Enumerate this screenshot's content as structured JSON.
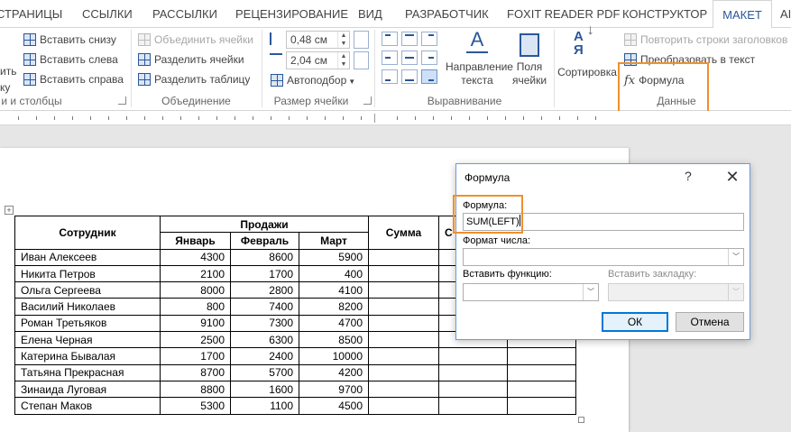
{
  "tabs": [
    "СТРАНИЦЫ",
    "ССЫЛКИ",
    "РАССЫЛКИ",
    "РЕЦЕНЗИРОВАНИЕ",
    "ВИД",
    "РАЗРАБОТЧИК",
    "FOXIT READER PDF",
    "КОНСТРУКТОР",
    "МАКЕТ",
    "AI"
  ],
  "ribbon": {
    "rows_cols": {
      "cut_label1": "ить",
      "cut_label2": "ку",
      "insert_below": "Вставить снизу",
      "insert_left": "Вставить слева",
      "insert_right": "Вставить справа",
      "group": "и и столбцы"
    },
    "merge": {
      "merge_cells": "Объединить ячейки",
      "split_cells": "Разделить ячейки",
      "split_table": "Разделить таблицу",
      "group": "Объединение"
    },
    "cell_size": {
      "height": "0,48 см",
      "width": "2,04 см",
      "autofit": "Автоподбор",
      "group": "Размер ячейки"
    },
    "alignment": {
      "text_direction_l1": "Направление",
      "text_direction_l2": "текста",
      "margins_l1": "Поля",
      "margins_l2": "ячейки",
      "group": "Выравнивание"
    },
    "data": {
      "sort": "Сортировка",
      "repeat_headers": "Повторить строки заголовков",
      "convert": "Преобразовать в текст",
      "formula": "Формула",
      "formula_icon": "fx",
      "group": "Данные"
    }
  },
  "table": {
    "head_employee": "Сотрудник",
    "head_sales": "Продажи",
    "head_sum": "Сумма",
    "head_extra": "С",
    "months": [
      "Январь",
      "Февраль",
      "Март"
    ],
    "rows": [
      [
        "Иван Алексеев",
        "4300",
        "8600",
        "5900"
      ],
      [
        "Никита Петров",
        "2100",
        "1700",
        "400"
      ],
      [
        "Ольга Сергеева",
        "8000",
        "2800",
        "4100"
      ],
      [
        "Василий Николаев",
        "800",
        "7400",
        "8200"
      ],
      [
        "Роман Третьяков",
        "9100",
        "7300",
        "4700"
      ],
      [
        "Елена Черная",
        "2500",
        "6300",
        "8500"
      ],
      [
        "Катерина Бывалая",
        "1700",
        "2400",
        "10000"
      ],
      [
        "Татьяна Прекрасная",
        "8700",
        "5700",
        "4200"
      ],
      [
        "Зинаида Луговая",
        "8800",
        "1600",
        "9700"
      ],
      [
        "Степан Маков",
        "5300",
        "1100",
        "4500"
      ]
    ]
  },
  "dialog": {
    "title": "Формула",
    "help": "?",
    "close": "✕",
    "formula_label": "Формула:",
    "formula_value": "SUM(LEFT)",
    "number_format_label": "Формат числа:",
    "insert_function_label": "Вставить функцию:",
    "insert_bookmark_label": "Вставить закладку:",
    "ok": "ОК",
    "cancel": "Отмена"
  },
  "colors": {
    "highlight": "#f0902c",
    "accent": "#2b579a"
  }
}
